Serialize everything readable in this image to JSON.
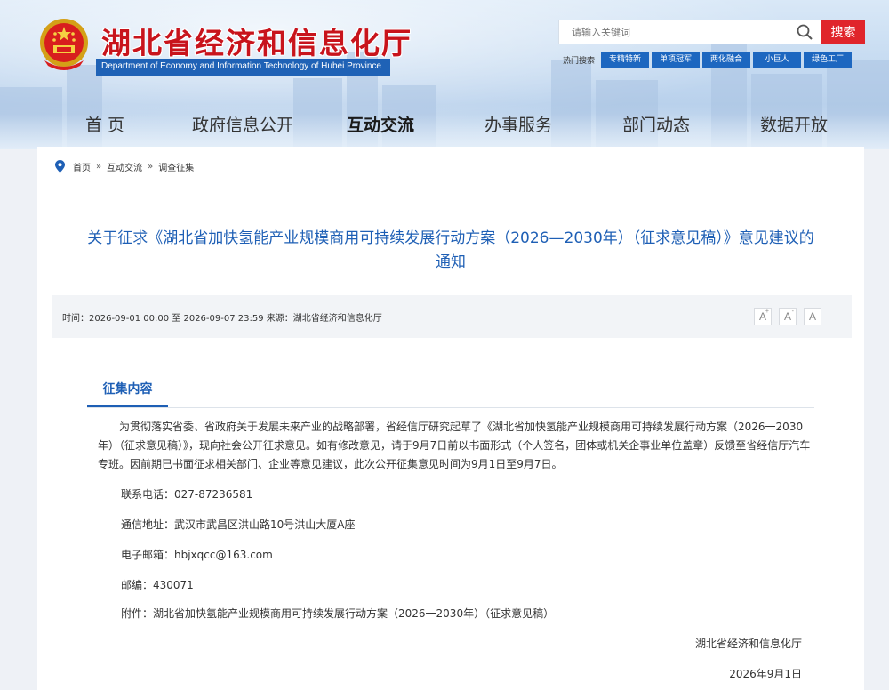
{
  "header": {
    "site_title": "湖北省经济和信息化厅",
    "site_subtitle": "Department of Economy and Information Technology of Hubei Province",
    "emblem_icon": "national-emblem-icon"
  },
  "search": {
    "placeholder": "请输入关键词",
    "button_label": "搜索",
    "hot_label": "热门搜索",
    "hot_tags": [
      "专精特新",
      "单项冠军",
      "两化融合",
      "小巨人",
      "绿色工厂"
    ]
  },
  "nav": {
    "items": [
      "首 页",
      "政府信息公开",
      "互动交流",
      "办事服务",
      "部门动态",
      "数据开放"
    ],
    "active_index": 2
  },
  "breadcrumb": {
    "icon": "location-pin-icon",
    "items": [
      "首页",
      "互动交流",
      "调查征集"
    ],
    "separator": "»"
  },
  "article": {
    "title_line1": "关于征求《湖北省加快氢能产业规模商用可持续发展行动方案（2026—2030年）（征求意见稿）》意见建议的",
    "title_line2": "通知",
    "meta": "时间：2026-09-01 00:00 至 2026-09-07 23:59    来源：湖北省经济和信息化厅",
    "font_buttons": [
      "A",
      "A",
      "A"
    ],
    "section_tab": "征集内容",
    "paragraph": "为贯彻落实省委、省政府关于发展未来产业的战略部署，省经信厅研究起草了《湖北省加快氢能产业规模商用可持续发展行动方案（2026一2030年）（征求意见稿）》，现向社会公开征求意见。如有修改意见，请于9月7日前以书面形式（个人签名，团体或机关企事业单位盖章）反馈至省经信厅汽车专班。因前期已书面征求相关部门、企业等意见建议，此次公开征集意见时间为9月1日至9月7日。",
    "phone": "联系电话：027-87236581",
    "address": "通信地址：武汉市武昌区洪山路10号洪山大厦A座",
    "email": "电子邮箱：hbjxqcc@163.com",
    "postcode": "邮编：430071",
    "attachment": "附件：湖北省加快氢能产业规模商用可持续发展行动方案（2026一2030年）（征求意见稿）",
    "signature_org": "湖北省经济和信息化厅",
    "signature_date": "2026年9月1日"
  },
  "colors": {
    "brand_red": "#c8141c",
    "brand_blue": "#1e5fb5",
    "search_red": "#e0252b",
    "tag_blue": "#1d67c0"
  }
}
